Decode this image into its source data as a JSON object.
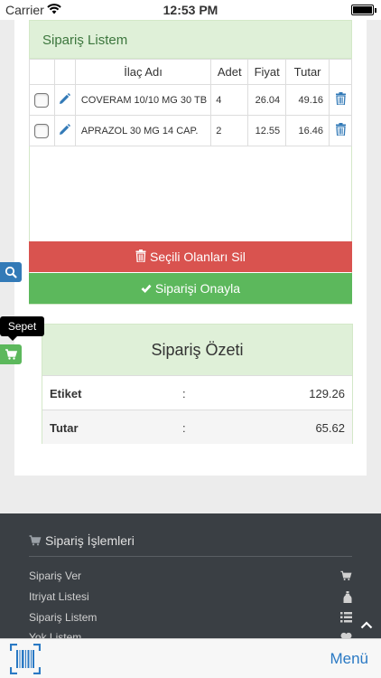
{
  "status_bar": {
    "carrier": "Carrier",
    "time": "12:53 PM"
  },
  "order_list": {
    "title": "Sipariş Listem",
    "columns": [
      "",
      "",
      "İlaç Adı",
      "Adet",
      "Fiyat",
      "Tutar",
      ""
    ],
    "rows": [
      {
        "name": "COVERAM 10/10 MG 30 TB",
        "qty": "4",
        "price": "26.04",
        "total": "49.16"
      },
      {
        "name": "APRAZOL 30 MG 14 CAP.",
        "qty": "2",
        "price": "12.55",
        "total": "16.46"
      }
    ],
    "delete_selected_label": "Seçili Olanları Sil",
    "confirm_order_label": "Siparişi Onayla"
  },
  "summary": {
    "title": "Sipariş Özeti",
    "rows": [
      {
        "label": "Etiket",
        "sep": ":",
        "value": "129.26"
      },
      {
        "label": "Tutar",
        "sep": ":",
        "value": "65.62"
      }
    ]
  },
  "side": {
    "cart_tooltip": "Sepet"
  },
  "footer": {
    "title": "Sipariş İşlemleri",
    "items": [
      {
        "label": "Sipariş Ver",
        "icon": "cart-icon"
      },
      {
        "label": "Itriyat Listesi",
        "icon": "bottle-icon"
      },
      {
        "label": "Sipariş Listem",
        "icon": "list-icon"
      },
      {
        "label": "Yok Listem",
        "icon": "heart-icon"
      }
    ]
  },
  "bottom_bar": {
    "menu_label": "Menü"
  },
  "colors": {
    "danger": "#d9534f",
    "success": "#5cb85c",
    "primary": "#337ab7",
    "panel_head": "#dff0d8",
    "footer_bg": "#3a3f44"
  }
}
